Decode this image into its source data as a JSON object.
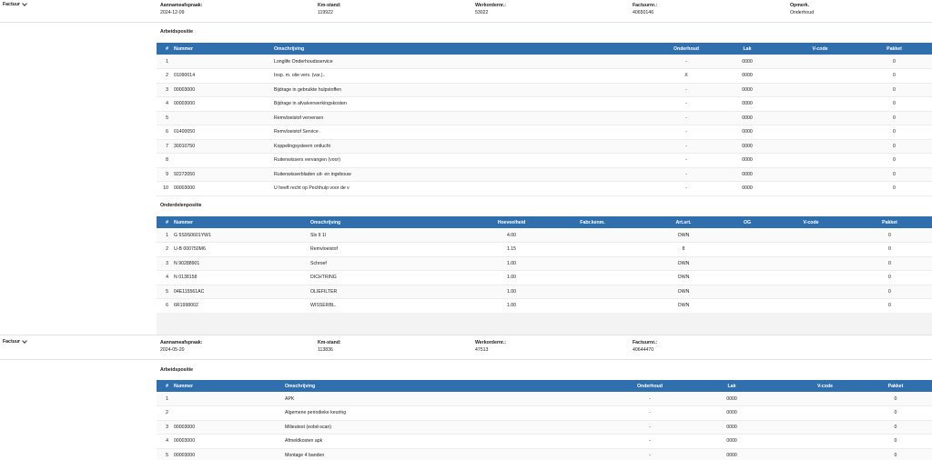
{
  "blocks": [
    {
      "toggle_label": "Factuur",
      "fields": [
        {
          "label": "Aannameafspraak:",
          "value": "2024-12-09"
        },
        {
          "label": "Km-stand:",
          "value": "119922"
        },
        {
          "label": "Werkordernr.:",
          "value": "53022"
        },
        {
          "label": "Factuurnr.:",
          "value": "40650146"
        },
        {
          "label": "Opmerk.",
          "value": "Onderhoud"
        }
      ],
      "arbeid": {
        "title": "Arbeidspositie",
        "headers": [
          "#",
          "Nummer",
          "Omschrijving",
          "Onderhoud",
          "Lak",
          "V-code",
          "Pakket"
        ],
        "rows": [
          [
            "1",
            "",
            "Longlife Onderhoudsservice",
            "-",
            "0000",
            "",
            "0"
          ],
          [
            "2",
            "01090014",
            "Insp. m. olie verv. (var.)..",
            "X",
            "0000",
            "",
            "0"
          ],
          [
            "3",
            "00003000",
            "Bijdrage in gebruikte hulpstoffen",
            "-",
            "0000",
            "",
            "0"
          ],
          [
            "4",
            "00003000",
            "Bijdrage in afvalverwerkingskosten",
            "-",
            "0000",
            "",
            "0"
          ],
          [
            "5",
            "",
            "Remvloeistof verversen",
            "-",
            "0000",
            "",
            "0"
          ],
          [
            "6",
            "01400050",
            "Remvloeistof Service .",
            "-",
            "0000",
            "",
            "0"
          ],
          [
            "7",
            "30010750",
            "Koppelingsysteem ontlucht",
            "-",
            "0000",
            "",
            "0"
          ],
          [
            "8",
            "",
            "Ruitenwissers vervangen (voor)",
            "-",
            "0000",
            "",
            "0"
          ],
          [
            "9",
            "92272050",
            "Ruitenwisserbladen uit- en ingebouw",
            "-",
            "0000",
            "",
            "0"
          ],
          [
            "10",
            "00003000",
            "U heeft recht op Pechhulp voor de v",
            "-",
            "0000",
            "",
            "0"
          ]
        ]
      },
      "onderdelen": {
        "title": "Onderdelenpositie",
        "headers": [
          "#",
          "Nummer",
          "Omschrijving",
          "Hoeveelheid",
          "Fabr.kenm.",
          "Art.srt.",
          "OG",
          "V-code",
          "Pakket"
        ],
        "rows": [
          [
            "1",
            "G 5S9S0601YW1",
            "Slx II 1l",
            "4.00",
            "",
            "OWN",
            "",
            "",
            "0"
          ],
          [
            "2",
            "U-B 000750M6",
            "Remvloeistof",
            "1.15",
            "",
            "8",
            "",
            "",
            "0"
          ],
          [
            "3",
            "N 90288901",
            "Schroef",
            "1.00",
            "",
            "OWN",
            "",
            "",
            "0"
          ],
          [
            "4",
            "N 0138158",
            "DICHTRING",
            "1.00",
            "",
            "OWN",
            "",
            "",
            "0"
          ],
          [
            "5",
            "04E115561AC",
            "OLIEFILTER",
            "1.00",
            "",
            "OWN",
            "",
            "",
            "0"
          ],
          [
            "6",
            "6R1998002",
            "WISSERBL.",
            "1.00",
            "",
            "OWN",
            "",
            "",
            "0"
          ]
        ]
      }
    },
    {
      "toggle_label": "Factuur",
      "fields": [
        {
          "label": "Aannameafspraak:",
          "value": "2024-05-20"
        },
        {
          "label": "Km-stand:",
          "value": "113836"
        },
        {
          "label": "Werkordernr.:",
          "value": "47513"
        },
        {
          "label": "Factuurnr.:",
          "value": "40644470"
        }
      ],
      "arbeid": {
        "title": "Arbeidspositie",
        "headers": [
          "#",
          "Nummer",
          "Omschrijving",
          "Onderhoud",
          "Lak",
          "V-code",
          "Pakket"
        ],
        "rows": [
          [
            "1",
            "",
            "APK",
            "-",
            "0000",
            "",
            "0"
          ],
          [
            "2",
            "",
            "Algemene periodieke keuring",
            "-",
            "0000",
            "",
            "0"
          ],
          [
            "3",
            "00003000",
            "Milieutest (eobd-scan)",
            "-",
            "0000",
            "",
            "0"
          ],
          [
            "4",
            "00003000",
            "Afmeldkosten apk",
            "-",
            "0000",
            "",
            "0"
          ],
          [
            "5",
            "00003000",
            "Montage 4 banden",
            "-",
            "0000",
            "",
            "0"
          ]
        ]
      }
    }
  ]
}
